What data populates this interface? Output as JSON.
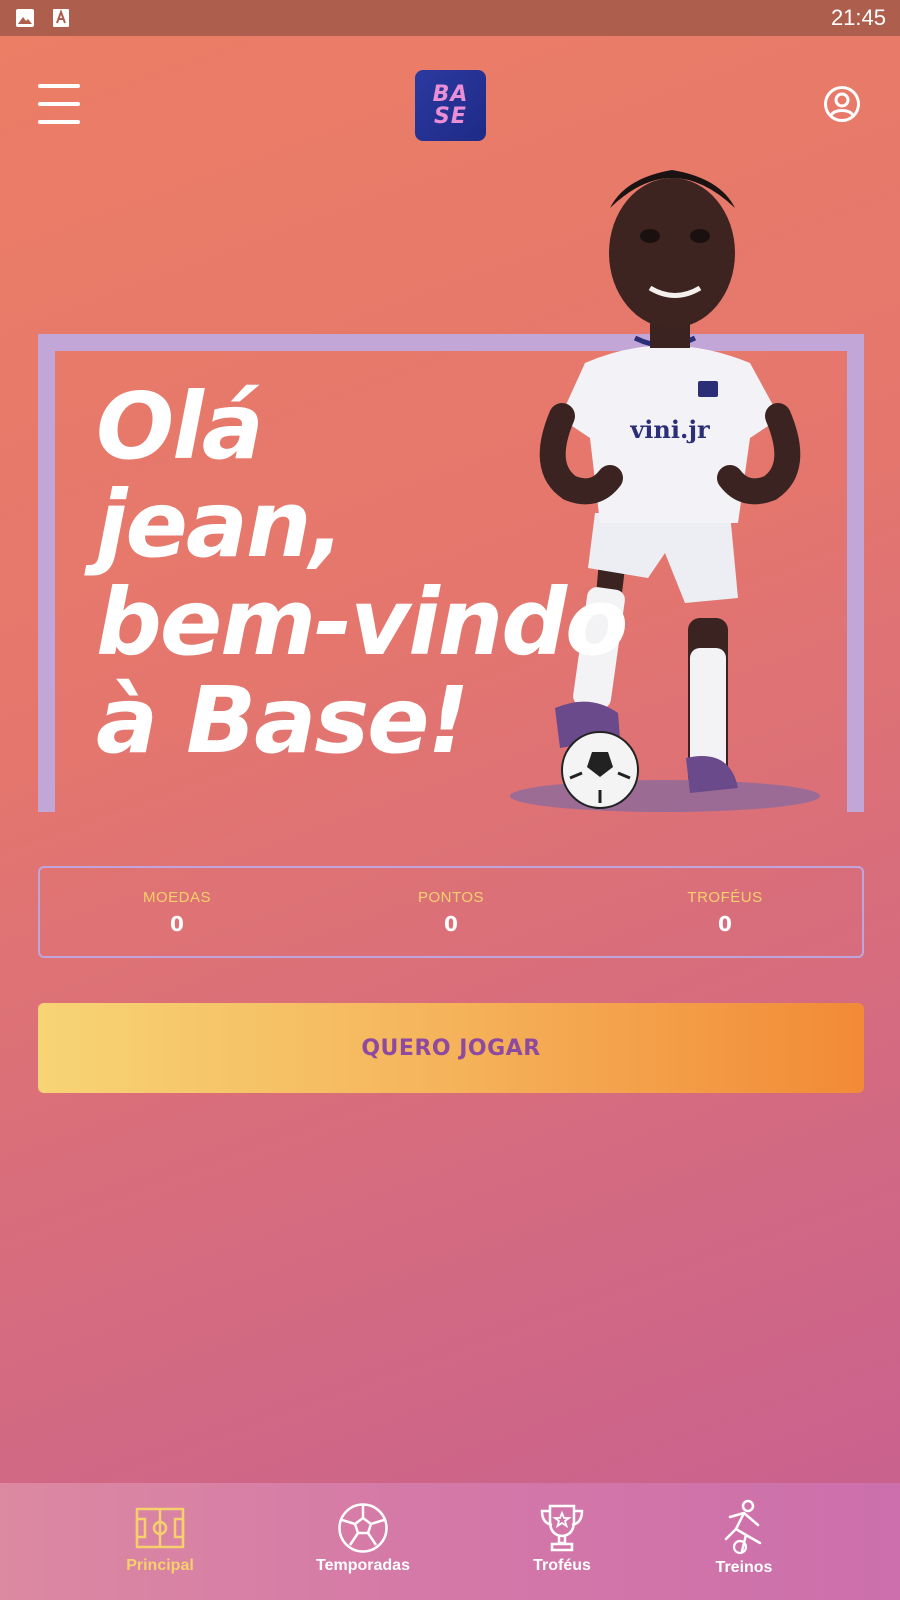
{
  "status_bar": {
    "time": "21:45",
    "icons": [
      "image-icon",
      "font-icon"
    ]
  },
  "header": {
    "menu_icon": "hamburger-icon",
    "logo_lines": [
      "BA",
      "SE"
    ],
    "profile_icon": "user-circle-icon"
  },
  "hero": {
    "greeting_lines": [
      "Olá",
      "jean,",
      "bem-vindo",
      "à Base!"
    ],
    "player_shirt_text": "vini.jr"
  },
  "stats": [
    {
      "label": "MOEDAS",
      "value": "0"
    },
    {
      "label": "PONTOS",
      "value": "0"
    },
    {
      "label": "TROFÉUS",
      "value": "0"
    }
  ],
  "play_button": {
    "label": "QUERO JOGAR"
  },
  "bottom_nav": {
    "items": [
      {
        "label": "Principal",
        "icon": "field-icon",
        "active": true
      },
      {
        "label": "Temporadas",
        "icon": "soccer-ball-icon",
        "active": false
      },
      {
        "label": "Troféus",
        "icon": "trophy-icon",
        "active": false
      },
      {
        "label": "Treinos",
        "icon": "training-player-icon",
        "active": false
      }
    ]
  },
  "colors": {
    "accent_yellow": "#f6d06c",
    "button_text": "#8d4aa0",
    "goal_frame": "#c3a6d8",
    "logo_bg": "#2c3aa0"
  }
}
